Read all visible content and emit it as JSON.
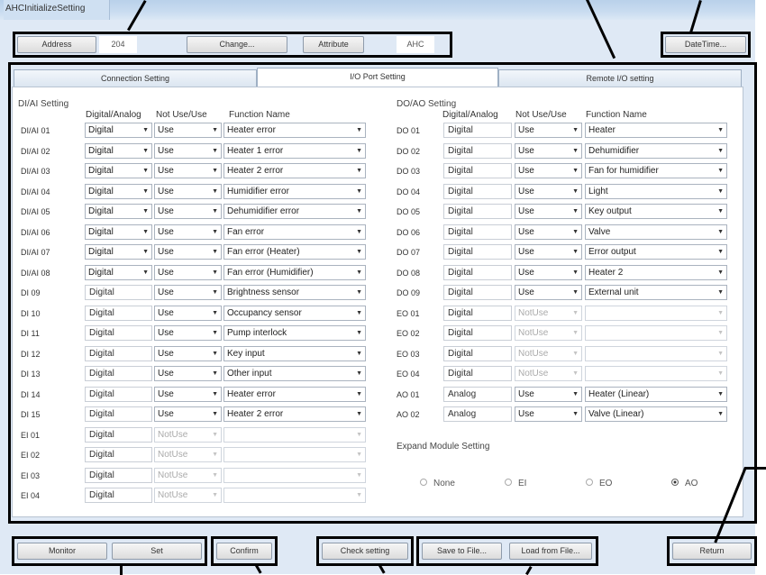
{
  "window_title": "AHCInitializeSetting",
  "top": {
    "address_label": "Address",
    "address_value": "204",
    "change_label": "Change...",
    "attribute_label": "Attribute",
    "attribute_value": "AHC",
    "datetime_label": "DateTime..."
  },
  "tabs": [
    {
      "label": "Connection Setting"
    },
    {
      "label": "I/O Port Setting"
    },
    {
      "label": "Remote I/O setting"
    }
  ],
  "di": {
    "title": "DI/AI Setting",
    "col_digital": "Digital/Analog",
    "col_use": "Not Use/Use",
    "col_func": "Function Name",
    "rows": [
      {
        "label": "DI/AI 01",
        "da": "Digital",
        "use": "Use",
        "func": "Heater error",
        "da_combo": true,
        "disabled": false
      },
      {
        "label": "DI/AI 02",
        "da": "Digital",
        "use": "Use",
        "func": "Heater 1 error",
        "da_combo": true,
        "disabled": false
      },
      {
        "label": "DI/AI 03",
        "da": "Digital",
        "use": "Use",
        "func": "Heater 2 error",
        "da_combo": true,
        "disabled": false
      },
      {
        "label": "DI/AI 04",
        "da": "Digital",
        "use": "Use",
        "func": "Humidifier error",
        "da_combo": true,
        "disabled": false
      },
      {
        "label": "DI/AI 05",
        "da": "Digital",
        "use": "Use",
        "func": "Dehumidifier error",
        "da_combo": true,
        "disabled": false
      },
      {
        "label": "DI/AI 06",
        "da": "Digital",
        "use": "Use",
        "func": "Fan error",
        "da_combo": true,
        "disabled": false
      },
      {
        "label": "DI/AI 07",
        "da": "Digital",
        "use": "Use",
        "func": "Fan error (Heater)",
        "da_combo": true,
        "disabled": false
      },
      {
        "label": "DI/AI 08",
        "da": "Digital",
        "use": "Use",
        "func": "Fan error (Humidifier)",
        "da_combo": true,
        "disabled": false
      },
      {
        "label": "DI 09",
        "da": "Digital",
        "use": "Use",
        "func": "Brightness sensor",
        "da_combo": false,
        "disabled": false
      },
      {
        "label": "DI 10",
        "da": "Digital",
        "use": "Use",
        "func": "Occupancy sensor",
        "da_combo": false,
        "disabled": false
      },
      {
        "label": "DI 11",
        "da": "Digital",
        "use": "Use",
        "func": "Pump interlock",
        "da_combo": false,
        "disabled": false
      },
      {
        "label": "DI 12",
        "da": "Digital",
        "use": "Use",
        "func": "Key input",
        "da_combo": false,
        "disabled": false
      },
      {
        "label": "DI 13",
        "da": "Digital",
        "use": "Use",
        "func": "Other input",
        "da_combo": false,
        "disabled": false
      },
      {
        "label": "DI 14",
        "da": "Digital",
        "use": "Use",
        "func": "Heater error",
        "da_combo": false,
        "disabled": false
      },
      {
        "label": "DI 15",
        "da": "Digital",
        "use": "Use",
        "func": "Heater 2 error",
        "da_combo": false,
        "disabled": false
      },
      {
        "label": "EI 01",
        "da": "Digital",
        "use": "NotUse",
        "func": "",
        "da_combo": false,
        "disabled": true
      },
      {
        "label": "EI 02",
        "da": "Digital",
        "use": "NotUse",
        "func": "",
        "da_combo": false,
        "disabled": true
      },
      {
        "label": "EI 03",
        "da": "Digital",
        "use": "NotUse",
        "func": "",
        "da_combo": false,
        "disabled": true
      },
      {
        "label": "EI 04",
        "da": "Digital",
        "use": "NotUse",
        "func": "",
        "da_combo": false,
        "disabled": true
      }
    ]
  },
  "do": {
    "title": "DO/AO Setting",
    "col_digital": "Digital/Analog",
    "col_use": "Not Use/Use",
    "col_func": "Function Name",
    "rows": [
      {
        "label": "DO 01",
        "da": "Digital",
        "use": "Use",
        "func": "Heater",
        "disabled": false
      },
      {
        "label": "DO 02",
        "da": "Digital",
        "use": "Use",
        "func": "Dehumidifier",
        "disabled": false
      },
      {
        "label": "DO 03",
        "da": "Digital",
        "use": "Use",
        "func": "Fan for humidifier",
        "disabled": false
      },
      {
        "label": "DO 04",
        "da": "Digital",
        "use": "Use",
        "func": "Light",
        "disabled": false
      },
      {
        "label": "DO 05",
        "da": "Digital",
        "use": "Use",
        "func": "Key output",
        "disabled": false
      },
      {
        "label": "DO 06",
        "da": "Digital",
        "use": "Use",
        "func": "Valve",
        "disabled": false
      },
      {
        "label": "DO 07",
        "da": "Digital",
        "use": "Use",
        "func": "Error output",
        "disabled": false
      },
      {
        "label": "DO 08",
        "da": "Digital",
        "use": "Use",
        "func": "Heater 2",
        "disabled": false
      },
      {
        "label": "DO 09",
        "da": "Digital",
        "use": "Use",
        "func": "External unit",
        "disabled": false
      },
      {
        "label": "EO 01",
        "da": "Digital",
        "use": "NotUse",
        "func": "",
        "disabled": true
      },
      {
        "label": "EO 02",
        "da": "Digital",
        "use": "NotUse",
        "func": "",
        "disabled": true
      },
      {
        "label": "EO 03",
        "da": "Digital",
        "use": "NotUse",
        "func": "",
        "disabled": true
      },
      {
        "label": "EO 04",
        "da": "Digital",
        "use": "NotUse",
        "func": "",
        "disabled": true
      },
      {
        "label": "AO 01",
        "da": "Analog",
        "use": "Use",
        "func": "Heater (Linear)",
        "disabled": false
      },
      {
        "label": "AO 02",
        "da": "Analog",
        "use": "Use",
        "func": "Valve (Linear)",
        "disabled": false
      }
    ]
  },
  "expand": {
    "title": "Expand Module Setting",
    "options": [
      {
        "label": "None",
        "checked": false
      },
      {
        "label": "EI",
        "checked": false
      },
      {
        "label": "EO",
        "checked": false
      },
      {
        "label": "AO",
        "checked": true
      }
    ]
  },
  "bottom": {
    "monitor": "Monitor",
    "set": "Set",
    "confirm": "Confirm",
    "check": "Check setting",
    "save": "Save to File...",
    "load": "Load from File...",
    "return": "Return"
  }
}
